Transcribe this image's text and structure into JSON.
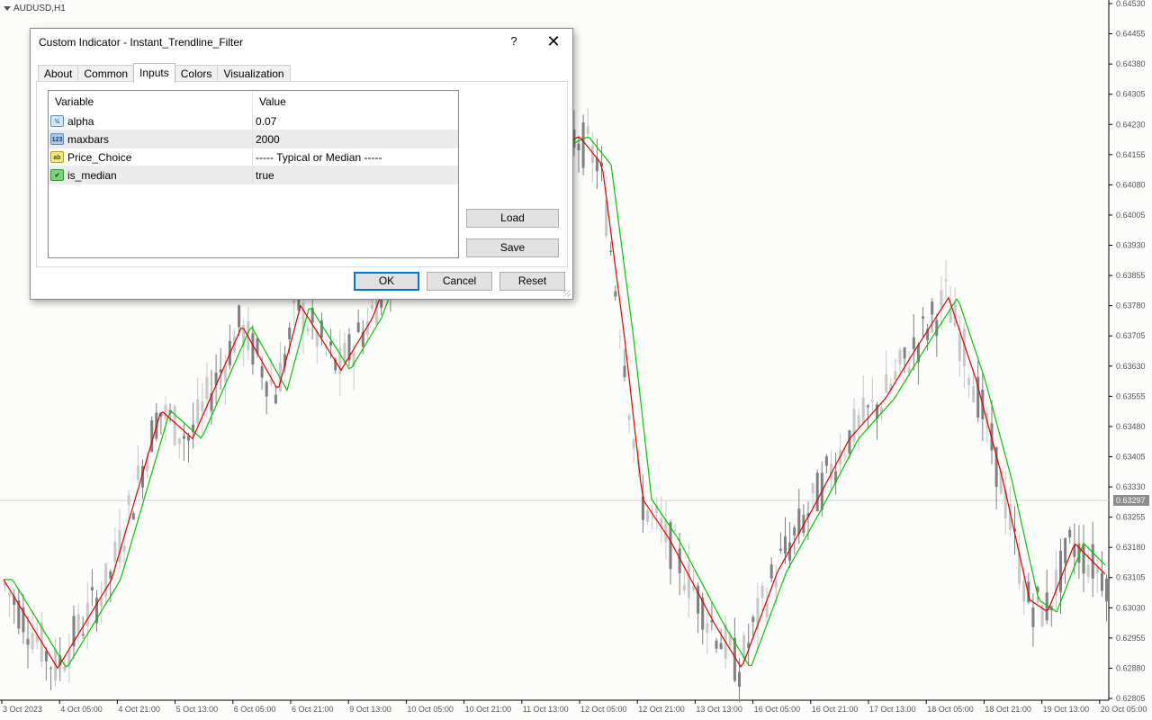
{
  "chart": {
    "symbol": "AUDUSD,H1",
    "current_price": "0.63297",
    "price_axis": [
      "0.64530",
      "0.64455",
      "0.64380",
      "0.64305",
      "0.64230",
      "0.64155",
      "0.64080",
      "0.64005",
      "0.63930",
      "0.63855",
      "0.63780",
      "0.63705",
      "0.63630",
      "0.63555",
      "0.63480",
      "0.63405",
      "0.63330",
      "0.63255",
      "0.63180",
      "0.63105",
      "0.63030",
      "0.62955",
      "0.62880",
      "0.62805"
    ],
    "time_axis": [
      "3 Oct 2023",
      "4 Oct 05:00",
      "4 Oct 21:00",
      "5 Oct 13:00",
      "6 Oct 05:00",
      "6 Oct 21:00",
      "9 Oct 13:00",
      "10 Oct 05:00",
      "10 Oct 21:00",
      "11 Oct 13:00",
      "12 Oct 05:00",
      "12 Oct 21:00",
      "13 Oct 13:00",
      "16 Oct 05:00",
      "16 Oct 21:00",
      "17 Oct 13:00",
      "18 Oct 05:00",
      "18 Oct 21:00",
      "19 Oct 13:00",
      "20 Oct 05:00"
    ],
    "colors": {
      "bull_candle": "#c8c8c8",
      "bear_candle": "#808080",
      "fast_line": "#e00000",
      "slow_line": "#00c800",
      "grid_line": "#d0d0d0"
    },
    "overlay": {
      "ymin": 0.62805,
      "ymax": 0.6453
    }
  },
  "dialog": {
    "title": "Custom Indicator - Instant_Trendline_Filter",
    "help": "?",
    "close": "✕",
    "tabs": [
      "About",
      "Common",
      "Inputs",
      "Colors",
      "Visualization"
    ],
    "active_tab": "Inputs",
    "grid": {
      "header": {
        "variable": "Variable",
        "value": "Value"
      },
      "rows": [
        {
          "icon": "fraction-icon",
          "icon_text": "½",
          "variable": "alpha",
          "value": "0.07"
        },
        {
          "icon": "integer-icon",
          "icon_text": "123",
          "variable": "maxbars",
          "value": "2000"
        },
        {
          "icon": "string-icon",
          "icon_text": "ab",
          "variable": "Price_Choice",
          "value": "-----  Typical or Median  -----"
        },
        {
          "icon": "boolean-icon",
          "icon_text": "✔",
          "variable": "is_median",
          "value": "true"
        }
      ]
    },
    "buttons": {
      "load": "Load",
      "save": "Save",
      "ok": "OK",
      "cancel": "Cancel",
      "reset": "Reset"
    }
  }
}
